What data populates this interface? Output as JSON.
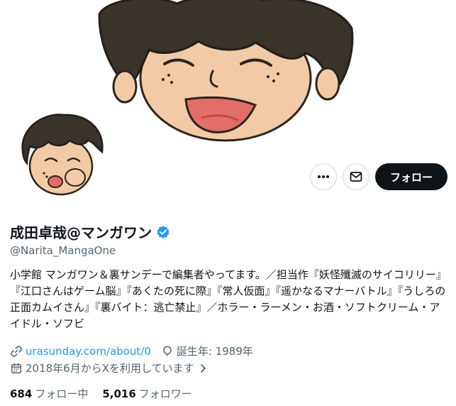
{
  "profile": {
    "display_name": "成田卓哉@マンガワン",
    "handle": "@Narita_MangaOne",
    "bio": "小学館 マンガワン＆裏サンデーで編集者やってます。／担当作『妖怪殲滅のサイコリリー』『江口さんはゲーム脳』『あくたの死に際』『常人仮面』『遥かなるマナーバトル』『うしろの正面カムイさん』『裏バイト：逃亡禁止』／ホラー・ラーメン・お酒・ソフトクリーム・アイドル・ソフビ",
    "website": "urasunday.com/about/0",
    "birth": "誕生年: 1989年",
    "joined": "2018年6月からXを利用しています"
  },
  "actions": {
    "follow_label": "フォロー"
  },
  "stats": {
    "following_count": "684",
    "following_label": "フォロー中",
    "followers_count": "5,016",
    "followers_label": "フォロワー"
  },
  "icons": {
    "more": "more-icon",
    "message": "mail-icon",
    "verified": "verified-badge-icon",
    "link": "link-icon",
    "birth": "balloon-icon",
    "calendar": "calendar-icon",
    "chevron": "chevron-right-icon"
  },
  "colors": {
    "accent": "#1d9bf0",
    "text": "#0f1419",
    "secondary": "#536471",
    "follow_bg": "#0f1419"
  }
}
